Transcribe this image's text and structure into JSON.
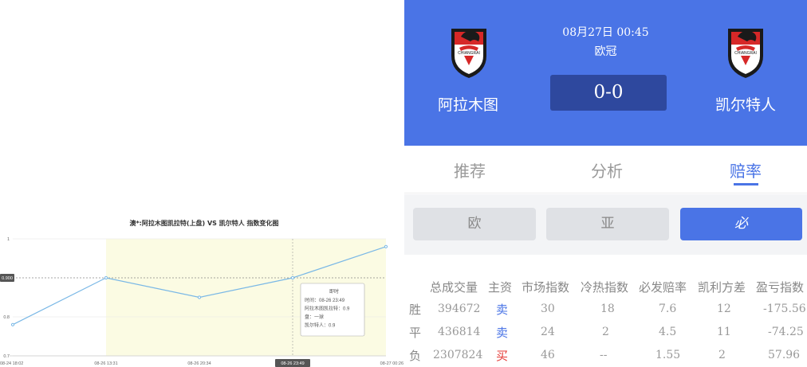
{
  "chart": {
    "title": "澳*:阿拉木图凯拉特(上盘) VS 凯尔特人 指数变化图",
    "x_labels": [
      "08-24 18:02",
      "08-26 13:31",
      "08-26 20:34",
      "08-26 23:49",
      "08-27 00:26"
    ],
    "y_labels": [
      "1",
      "0.900",
      "0.8",
      "0.7"
    ],
    "tooltip": {
      "title": "即时",
      "lines": [
        "时间：08-26 23:49",
        "阿拉木图凯拉特：0.9",
        "盘：一球",
        "凯尔特人：0.9"
      ]
    }
  },
  "chart_data": {
    "type": "line",
    "title": "澳*:阿拉木图凯拉特(上盘) VS 凯尔特人 指数变化图",
    "x": [
      "08-24 18:02",
      "08-26 13:31",
      "08-26 20:34",
      "08-26 23:49",
      "08-27 00:26"
    ],
    "series": [
      {
        "values": [
          0.78,
          0.9,
          0.85,
          0.9,
          0.98
        ]
      }
    ],
    "ylim": [
      0.7,
      1.0
    ],
    "highlighted_value": 0.9,
    "highlighted_x": "08-26 23:49",
    "grid": true
  },
  "match": {
    "datetime": "08月27日 00:45",
    "league": "欧冠",
    "score": "0-0",
    "home_team": "阿拉木图",
    "away_team": "凯尔特人",
    "logo_text": "CHIANGRAI"
  },
  "tabs": [
    "推荐",
    "分析",
    "赔率"
  ],
  "subtabs": [
    "欧",
    "亚",
    "必"
  ],
  "odds": {
    "headers": [
      "总成交量",
      "主资",
      "市场指数",
      "冷热指数",
      "必发赔率",
      "凯利方差",
      "盈亏指数"
    ],
    "rows": [
      {
        "label": "胜",
        "volume": "394672",
        "action": "卖",
        "market": "30",
        "heat": "18",
        "odds": "7.6",
        "kelly": "12",
        "pl": "-175.56"
      },
      {
        "label": "平",
        "volume": "436814",
        "action": "卖",
        "market": "24",
        "heat": "2",
        "odds": "4.5",
        "kelly": "11",
        "pl": "-74.25"
      },
      {
        "label": "负",
        "volume": "2307824",
        "action": "买",
        "market": "46",
        "heat": "--",
        "odds": "1.55",
        "kelly": "2",
        "pl": "57.96"
      }
    ]
  },
  "colors": {
    "accent": "#4a74e6",
    "header_bg": "#4a74e6",
    "score_bg": "#2e489e",
    "sell": "#4a74e6",
    "buy": "#e53935",
    "line": "#7ab8e6",
    "band": "#fbfbe3"
  }
}
